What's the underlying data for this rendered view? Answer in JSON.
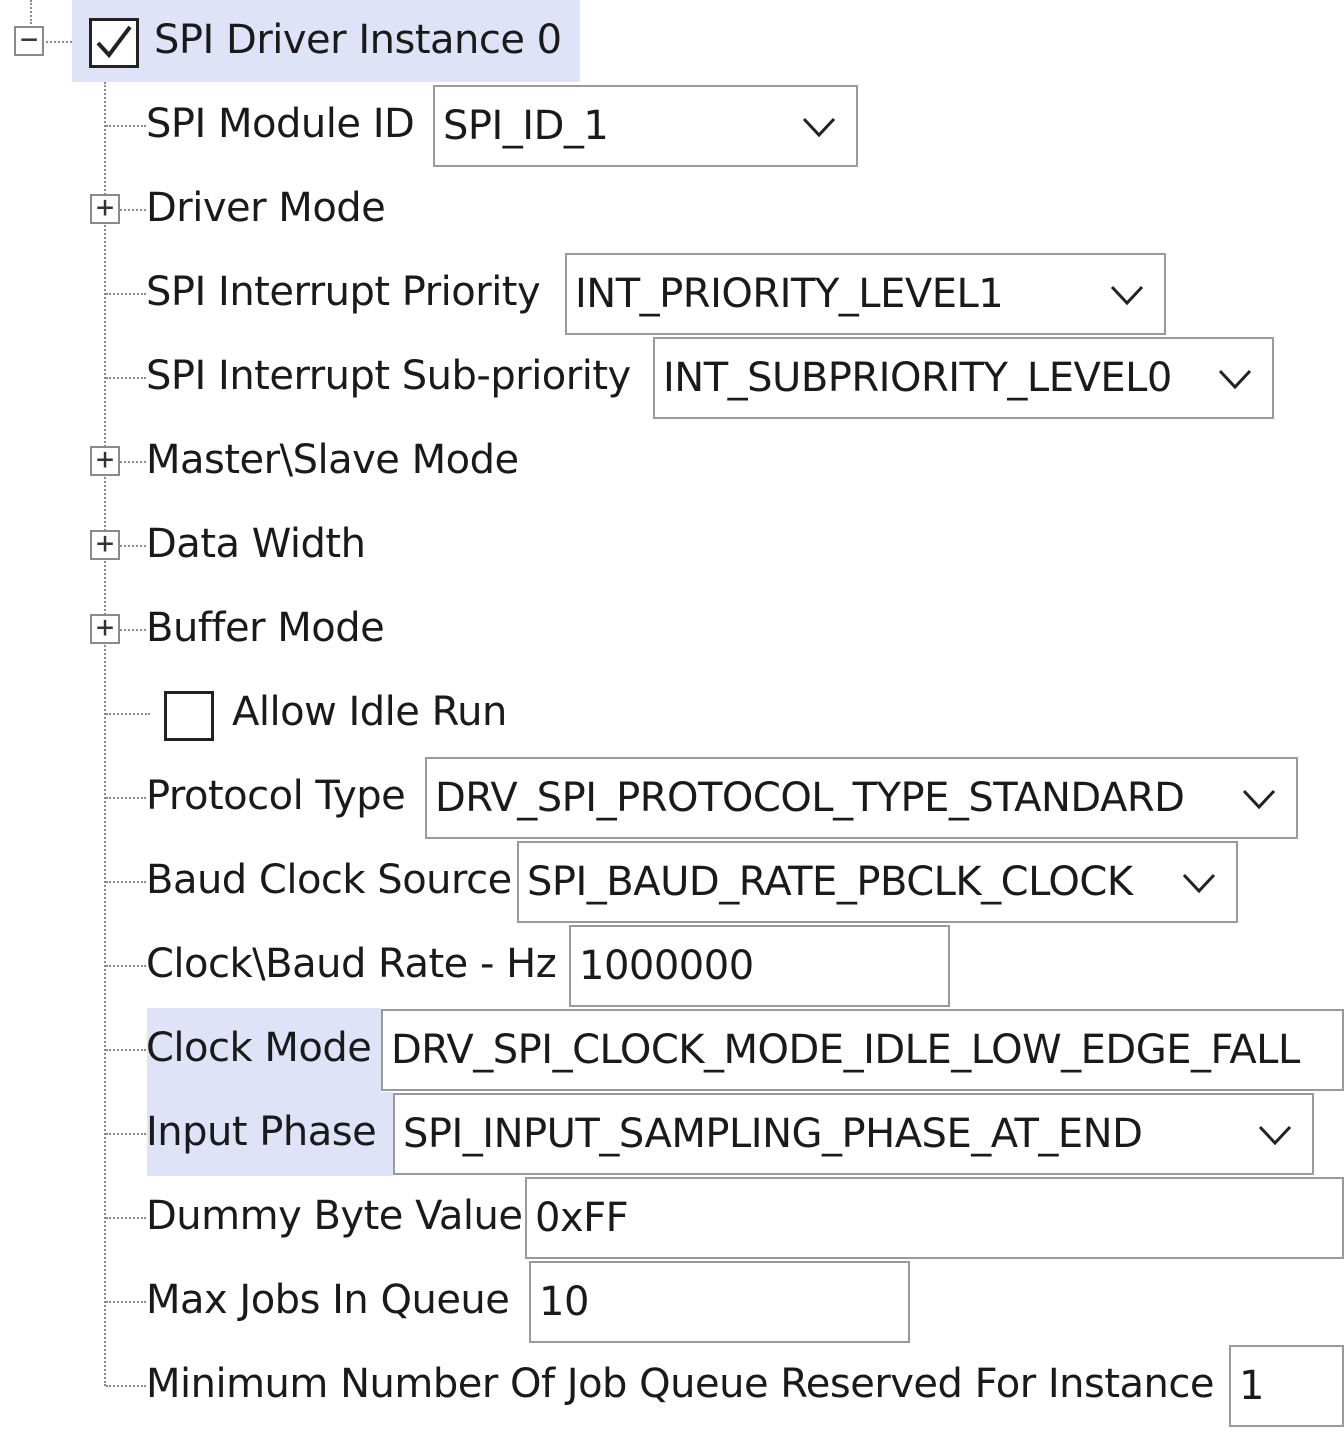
{
  "root": {
    "label": "SPI Driver Instance 0",
    "checked": true,
    "expander": "−"
  },
  "items": [
    {
      "key": "module_id",
      "label": "SPI Module ID",
      "type": "dropdown",
      "value": "SPI_ID_1"
    },
    {
      "key": "driver_mode",
      "label": "Driver Mode",
      "type": "group",
      "expander": "+"
    },
    {
      "key": "int_priority",
      "label": "SPI Interrupt Priority",
      "type": "dropdown",
      "value": "INT_PRIORITY_LEVEL1"
    },
    {
      "key": "int_subpriority",
      "label": "SPI Interrupt Sub-priority",
      "type": "dropdown",
      "value": "INT_SUBPRIORITY_LEVEL0"
    },
    {
      "key": "master_slave",
      "label": "Master\\Slave Mode",
      "type": "group",
      "expander": "+"
    },
    {
      "key": "data_width",
      "label": "Data Width",
      "type": "group",
      "expander": "+"
    },
    {
      "key": "buffer_mode",
      "label": "Buffer Mode",
      "type": "group",
      "expander": "+"
    },
    {
      "key": "allow_idle",
      "label": "Allow Idle Run",
      "type": "checkbox",
      "checked": false
    },
    {
      "key": "protocol_type",
      "label": "Protocol Type",
      "type": "dropdown",
      "value": "DRV_SPI_PROTOCOL_TYPE_STANDARD"
    },
    {
      "key": "baud_clock_source",
      "label": "Baud Clock Source",
      "type": "dropdown",
      "value": "SPI_BAUD_RATE_PBCLK_CLOCK"
    },
    {
      "key": "baud_rate",
      "label": "Clock\\Baud Rate - Hz",
      "type": "text",
      "value": "1000000"
    },
    {
      "key": "clock_mode",
      "label": "Clock Mode",
      "type": "dropdown",
      "value": "DRV_SPI_CLOCK_MODE_IDLE_LOW_EDGE_FALL",
      "highlighted": true
    },
    {
      "key": "input_phase",
      "label": "Input Phase",
      "type": "dropdown",
      "value": "SPI_INPUT_SAMPLING_PHASE_AT_END",
      "highlighted": true
    },
    {
      "key": "dummy_byte",
      "label": "Dummy Byte Value",
      "type": "text",
      "value": "0xFF"
    },
    {
      "key": "max_jobs",
      "label": "Max Jobs In Queue",
      "type": "text",
      "value": "10"
    },
    {
      "key": "min_job_queue",
      "label": "Minimum Number Of Job Queue Reserved For Instance",
      "type": "text",
      "value": "1"
    }
  ],
  "colors": {
    "highlight": "#dfe3f8",
    "tree_line": "#8a8a8a",
    "field_border": "#9a9a9a"
  },
  "icons": {
    "dropdown": "chevron-down-icon",
    "expand": "plus-box-icon",
    "collapse": "minus-box-icon",
    "check": "checkmark-icon"
  }
}
